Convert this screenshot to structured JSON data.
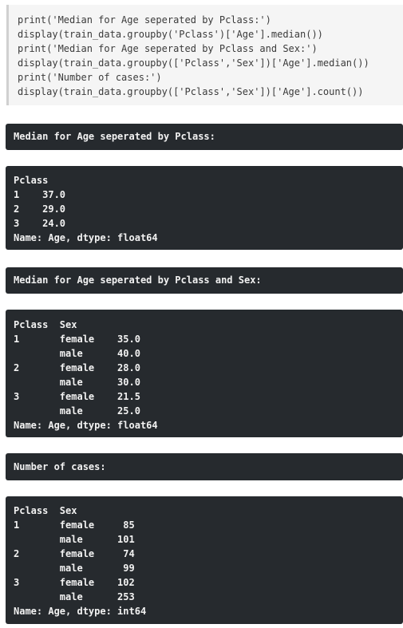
{
  "code_cell": {
    "lines": [
      "print('Median for Age seperated by Pclass:')",
      "display(train_data.groupby('Pclass')['Age'].median())",
      "print('Median for Age seperated by Pclass and Sex:')",
      "display(train_data.groupby(['Pclass','Sex'])['Age'].median())",
      "print('Number of cases:')",
      "display(train_data.groupby(['Pclass','Sex'])['Age'].count())"
    ]
  },
  "outputs": [
    {
      "lines": [
        "Median for Age seperated by Pclass:"
      ]
    },
    {
      "lines": [
        "Pclass",
        "1    37.0",
        "2    29.0",
        "3    24.0",
        "Name: Age, dtype: float64"
      ]
    },
    {
      "lines": [
        "Median for Age seperated by Pclass and Sex:"
      ]
    },
    {
      "lines": [
        "Pclass  Sex",
        "1       female    35.0",
        "        male      40.0",
        "2       female    28.0",
        "        male      30.0",
        "3       female    21.5",
        "        male      25.0",
        "Name: Age, dtype: float64"
      ]
    },
    {
      "lines": [
        "Number of cases:"
      ]
    },
    {
      "lines": [
        "Pclass  Sex",
        "1       female     85",
        "        male      101",
        "2       female     74",
        "        male       99",
        "3       female    102",
        "        male      253",
        "Name: Age, dtype: int64"
      ]
    }
  ]
}
